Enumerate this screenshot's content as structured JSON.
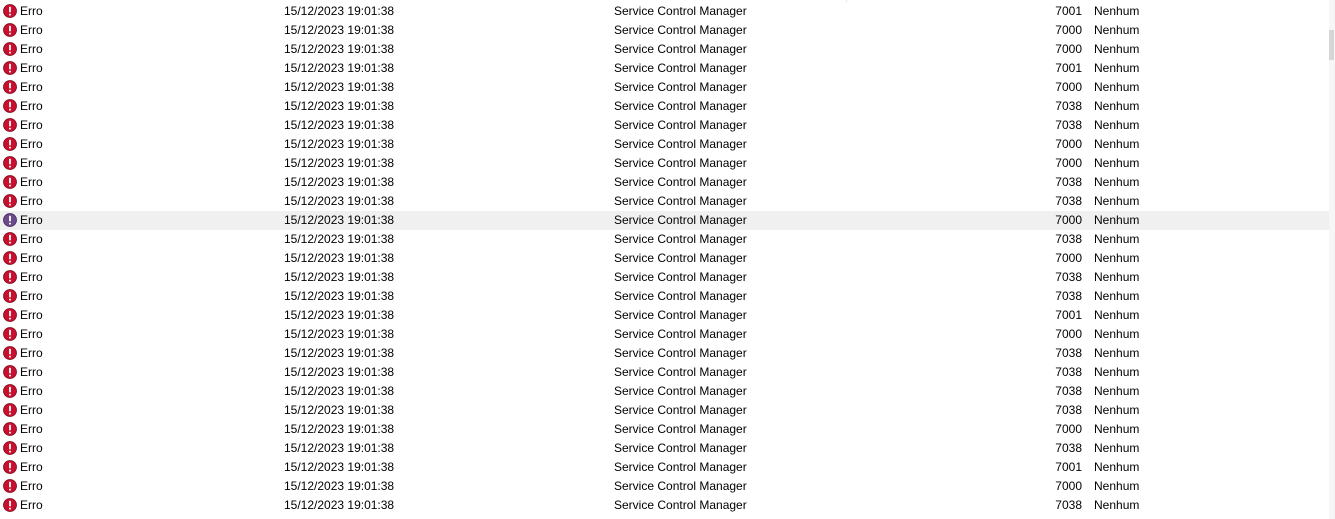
{
  "colors": {
    "error_icon": "#c8102e",
    "error_icon_selected": "#6a4a8a",
    "selected_row_bg": "#f0f0f0"
  },
  "event_list": {
    "icon_name": "error-icon",
    "rows": [
      {
        "level": "Erro",
        "datetime": "15/12/2023 19:01:38",
        "source": "Service Control Manager",
        "event_id": "7001",
        "task_category": "Nenhum"
      },
      {
        "level": "Erro",
        "datetime": "15/12/2023 19:01:38",
        "source": "Service Control Manager",
        "event_id": "7000",
        "task_category": "Nenhum"
      },
      {
        "level": "Erro",
        "datetime": "15/12/2023 19:01:38",
        "source": "Service Control Manager",
        "event_id": "7000",
        "task_category": "Nenhum"
      },
      {
        "level": "Erro",
        "datetime": "15/12/2023 19:01:38",
        "source": "Service Control Manager",
        "event_id": "7001",
        "task_category": "Nenhum"
      },
      {
        "level": "Erro",
        "datetime": "15/12/2023 19:01:38",
        "source": "Service Control Manager",
        "event_id": "7000",
        "task_category": "Nenhum"
      },
      {
        "level": "Erro",
        "datetime": "15/12/2023 19:01:38",
        "source": "Service Control Manager",
        "event_id": "7038",
        "task_category": "Nenhum"
      },
      {
        "level": "Erro",
        "datetime": "15/12/2023 19:01:38",
        "source": "Service Control Manager",
        "event_id": "7038",
        "task_category": "Nenhum"
      },
      {
        "level": "Erro",
        "datetime": "15/12/2023 19:01:38",
        "source": "Service Control Manager",
        "event_id": "7000",
        "task_category": "Nenhum"
      },
      {
        "level": "Erro",
        "datetime": "15/12/2023 19:01:38",
        "source": "Service Control Manager",
        "event_id": "7000",
        "task_category": "Nenhum"
      },
      {
        "level": "Erro",
        "datetime": "15/12/2023 19:01:38",
        "source": "Service Control Manager",
        "event_id": "7038",
        "task_category": "Nenhum"
      },
      {
        "level": "Erro",
        "datetime": "15/12/2023 19:01:38",
        "source": "Service Control Manager",
        "event_id": "7038",
        "task_category": "Nenhum"
      },
      {
        "level": "Erro",
        "datetime": "15/12/2023 19:01:38",
        "source": "Service Control Manager",
        "event_id": "7000",
        "task_category": "Nenhum",
        "selected": true
      },
      {
        "level": "Erro",
        "datetime": "15/12/2023 19:01:38",
        "source": "Service Control Manager",
        "event_id": "7038",
        "task_category": "Nenhum"
      },
      {
        "level": "Erro",
        "datetime": "15/12/2023 19:01:38",
        "source": "Service Control Manager",
        "event_id": "7000",
        "task_category": "Nenhum"
      },
      {
        "level": "Erro",
        "datetime": "15/12/2023 19:01:38",
        "source": "Service Control Manager",
        "event_id": "7038",
        "task_category": "Nenhum"
      },
      {
        "level": "Erro",
        "datetime": "15/12/2023 19:01:38",
        "source": "Service Control Manager",
        "event_id": "7038",
        "task_category": "Nenhum"
      },
      {
        "level": "Erro",
        "datetime": "15/12/2023 19:01:38",
        "source": "Service Control Manager",
        "event_id": "7001",
        "task_category": "Nenhum"
      },
      {
        "level": "Erro",
        "datetime": "15/12/2023 19:01:38",
        "source": "Service Control Manager",
        "event_id": "7000",
        "task_category": "Nenhum"
      },
      {
        "level": "Erro",
        "datetime": "15/12/2023 19:01:38",
        "source": "Service Control Manager",
        "event_id": "7038",
        "task_category": "Nenhum"
      },
      {
        "level": "Erro",
        "datetime": "15/12/2023 19:01:38",
        "source": "Service Control Manager",
        "event_id": "7038",
        "task_category": "Nenhum"
      },
      {
        "level": "Erro",
        "datetime": "15/12/2023 19:01:38",
        "source": "Service Control Manager",
        "event_id": "7038",
        "task_category": "Nenhum"
      },
      {
        "level": "Erro",
        "datetime": "15/12/2023 19:01:38",
        "source": "Service Control Manager",
        "event_id": "7038",
        "task_category": "Nenhum"
      },
      {
        "level": "Erro",
        "datetime": "15/12/2023 19:01:38",
        "source": "Service Control Manager",
        "event_id": "7000",
        "task_category": "Nenhum"
      },
      {
        "level": "Erro",
        "datetime": "15/12/2023 19:01:38",
        "source": "Service Control Manager",
        "event_id": "7038",
        "task_category": "Nenhum"
      },
      {
        "level": "Erro",
        "datetime": "15/12/2023 19:01:38",
        "source": "Service Control Manager",
        "event_id": "7001",
        "task_category": "Nenhum"
      },
      {
        "level": "Erro",
        "datetime": "15/12/2023 19:01:38",
        "source": "Service Control Manager",
        "event_id": "7000",
        "task_category": "Nenhum"
      },
      {
        "level": "Erro",
        "datetime": "15/12/2023 19:01:38",
        "source": "Service Control Manager",
        "event_id": "7038",
        "task_category": "Nenhum"
      }
    ]
  }
}
